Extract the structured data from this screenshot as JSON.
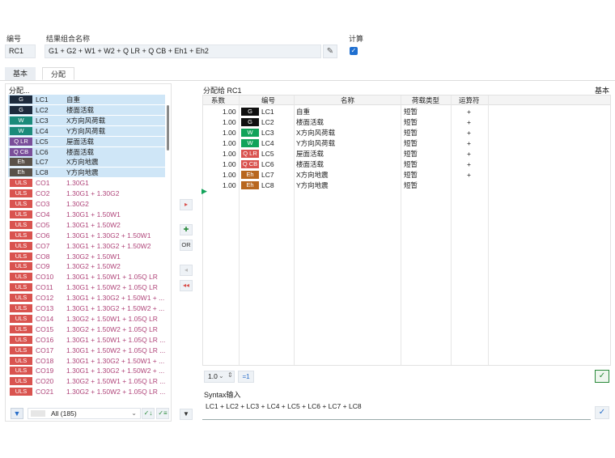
{
  "header": {
    "number_label": "编号",
    "number_value": "RC1",
    "name_label": "结果组合名称",
    "name_value": "G1 + G2 + W1 + W2 + Q LR + Q CB + Eh1 + Eh2",
    "calc_label": "计算"
  },
  "tabs": [
    {
      "label": "基本"
    },
    {
      "label": "分配"
    }
  ],
  "left": {
    "title": "分配...",
    "items": [
      {
        "badge": "G",
        "badge_color": "#1d2a3c",
        "id": "LC1",
        "name": "自重",
        "sel": true
      },
      {
        "badge": "G",
        "badge_color": "#1d2a3c",
        "id": "LC2",
        "name": "楼面活载",
        "sel": true
      },
      {
        "badge": "W",
        "badge_color": "#1b8a7a",
        "id": "LC3",
        "name": "X方向风荷载",
        "sel": true
      },
      {
        "badge": "W",
        "badge_color": "#1b8a7a",
        "id": "LC4",
        "name": "Y方向风荷载",
        "sel": true
      },
      {
        "badge": "Q LR",
        "badge_color": "#7a4e9a",
        "id": "LC5",
        "name": "屋面活载",
        "sel": true
      },
      {
        "badge": "Q CB",
        "badge_color": "#7a4e9a",
        "id": "LC6",
        "name": "楼面活载",
        "sel": true
      },
      {
        "badge": "Eh",
        "badge_color": "#5a5148",
        "id": "LC7",
        "name": "X方向地震",
        "sel": true
      },
      {
        "badge": "Eh",
        "badge_color": "#5a5148",
        "id": "LC8",
        "name": "Y方向地震",
        "sel": true
      },
      {
        "badge": "ULS",
        "badge_color": "#d9534f",
        "id": "CO1",
        "name": "1.30G1",
        "sel": false
      },
      {
        "badge": "ULS",
        "badge_color": "#d9534f",
        "id": "CO2",
        "name": "1.30G1 + 1.30G2",
        "sel": false
      },
      {
        "badge": "ULS",
        "badge_color": "#d9534f",
        "id": "CO3",
        "name": "1.30G2",
        "sel": false
      },
      {
        "badge": "ULS",
        "badge_color": "#d9534f",
        "id": "CO4",
        "name": "1.30G1 + 1.50W1",
        "sel": false
      },
      {
        "badge": "ULS",
        "badge_color": "#d9534f",
        "id": "CO5",
        "name": "1.30G1 + 1.50W2",
        "sel": false
      },
      {
        "badge": "ULS",
        "badge_color": "#d9534f",
        "id": "CO6",
        "name": "1.30G1 + 1.30G2 + 1.50W1",
        "sel": false
      },
      {
        "badge": "ULS",
        "badge_color": "#d9534f",
        "id": "CO7",
        "name": "1.30G1 + 1.30G2 + 1.50W2",
        "sel": false
      },
      {
        "badge": "ULS",
        "badge_color": "#d9534f",
        "id": "CO8",
        "name": "1.30G2 + 1.50W1",
        "sel": false
      },
      {
        "badge": "ULS",
        "badge_color": "#d9534f",
        "id": "CO9",
        "name": "1.30G2 + 1.50W2",
        "sel": false
      },
      {
        "badge": "ULS",
        "badge_color": "#d9534f",
        "id": "CO10",
        "name": "1.30G1 + 1.50W1 + 1.05Q LR",
        "sel": false
      },
      {
        "badge": "ULS",
        "badge_color": "#d9534f",
        "id": "CO11",
        "name": "1.30G1 + 1.50W2 + 1.05Q LR",
        "sel": false
      },
      {
        "badge": "ULS",
        "badge_color": "#d9534f",
        "id": "CO12",
        "name": "1.30G1 + 1.30G2 + 1.50W1 + ...",
        "sel": false
      },
      {
        "badge": "ULS",
        "badge_color": "#d9534f",
        "id": "CO13",
        "name": "1.30G1 + 1.30G2 + 1.50W2 + ...",
        "sel": false
      },
      {
        "badge": "ULS",
        "badge_color": "#d9534f",
        "id": "CO14",
        "name": "1.30G2 + 1.50W1 + 1.05Q LR",
        "sel": false
      },
      {
        "badge": "ULS",
        "badge_color": "#d9534f",
        "id": "CO15",
        "name": "1.30G2 + 1.50W2 + 1.05Q LR",
        "sel": false
      },
      {
        "badge": "ULS",
        "badge_color": "#d9534f",
        "id": "CO16",
        "name": "1.30G1 + 1.50W1 + 1.05Q LR ...",
        "sel": false
      },
      {
        "badge": "ULS",
        "badge_color": "#d9534f",
        "id": "CO17",
        "name": "1.30G1 + 1.50W2 + 1.05Q LR ...",
        "sel": false
      },
      {
        "badge": "ULS",
        "badge_color": "#d9534f",
        "id": "CO18",
        "name": "1.30G1 + 1.30G2 + 1.50W1 + ...",
        "sel": false
      },
      {
        "badge": "ULS",
        "badge_color": "#d9534f",
        "id": "CO19",
        "name": "1.30G1 + 1.30G2 + 1.50W2 + ...",
        "sel": false
      },
      {
        "badge": "ULS",
        "badge_color": "#d9534f",
        "id": "CO20",
        "name": "1.30G2 + 1.50W1 + 1.05Q LR ...",
        "sel": false
      },
      {
        "badge": "ULS",
        "badge_color": "#d9534f",
        "id": "CO21",
        "name": "1.30G2 + 1.50W2 + 1.05Q LR ...",
        "sel": false
      }
    ],
    "filter_value": "All (185)"
  },
  "middle": {
    "or_label": "OR"
  },
  "right": {
    "title": "分配给 RC1",
    "right_label": "基本",
    "columns": [
      "系数",
      "编号",
      "名称",
      "荷载类型",
      "运算符"
    ],
    "rows": [
      {
        "factor": "1.00",
        "badge": "G",
        "badge_color": "#111111",
        "id": "LC1",
        "name": "自重",
        "type": "短暂",
        "op": "+"
      },
      {
        "factor": "1.00",
        "badge": "G",
        "badge_color": "#111111",
        "id": "LC2",
        "name": "楼面活载",
        "type": "短暂",
        "op": "+"
      },
      {
        "factor": "1.00",
        "badge": "W",
        "badge_color": "#12a35a",
        "id": "LC3",
        "name": "X方向风荷载",
        "type": "短暂",
        "op": "+"
      },
      {
        "factor": "1.00",
        "badge": "W",
        "badge_color": "#12a35a",
        "id": "LC4",
        "name": "Y方向风荷载",
        "type": "短暂",
        "op": "+"
      },
      {
        "factor": "1.00",
        "badge": "Q LR",
        "badge_color": "#d9534f",
        "id": "LC5",
        "name": "屋面活载",
        "type": "短暂",
        "op": "+"
      },
      {
        "factor": "1.00",
        "badge": "Q CB",
        "badge_color": "#d9534f",
        "id": "LC6",
        "name": "楼面活载",
        "type": "短暂",
        "op": "+"
      },
      {
        "factor": "1.00",
        "badge": "Eh",
        "badge_color": "#b8671f",
        "id": "LC7",
        "name": "X方向地震",
        "type": "短暂",
        "op": "+"
      },
      {
        "factor": "1.00",
        "badge": "Eh",
        "badge_color": "#b8671f",
        "id": "LC8",
        "name": "Y方向地震",
        "type": "短暂",
        "op": ""
      }
    ],
    "factor_select": "1.0",
    "eq_button": "=1",
    "syntax_label": "Syntax输入",
    "syntax_value": "LC1 + LC2 + LC3 + LC4 + LC5 + LC6 + LC7 + LC8"
  }
}
